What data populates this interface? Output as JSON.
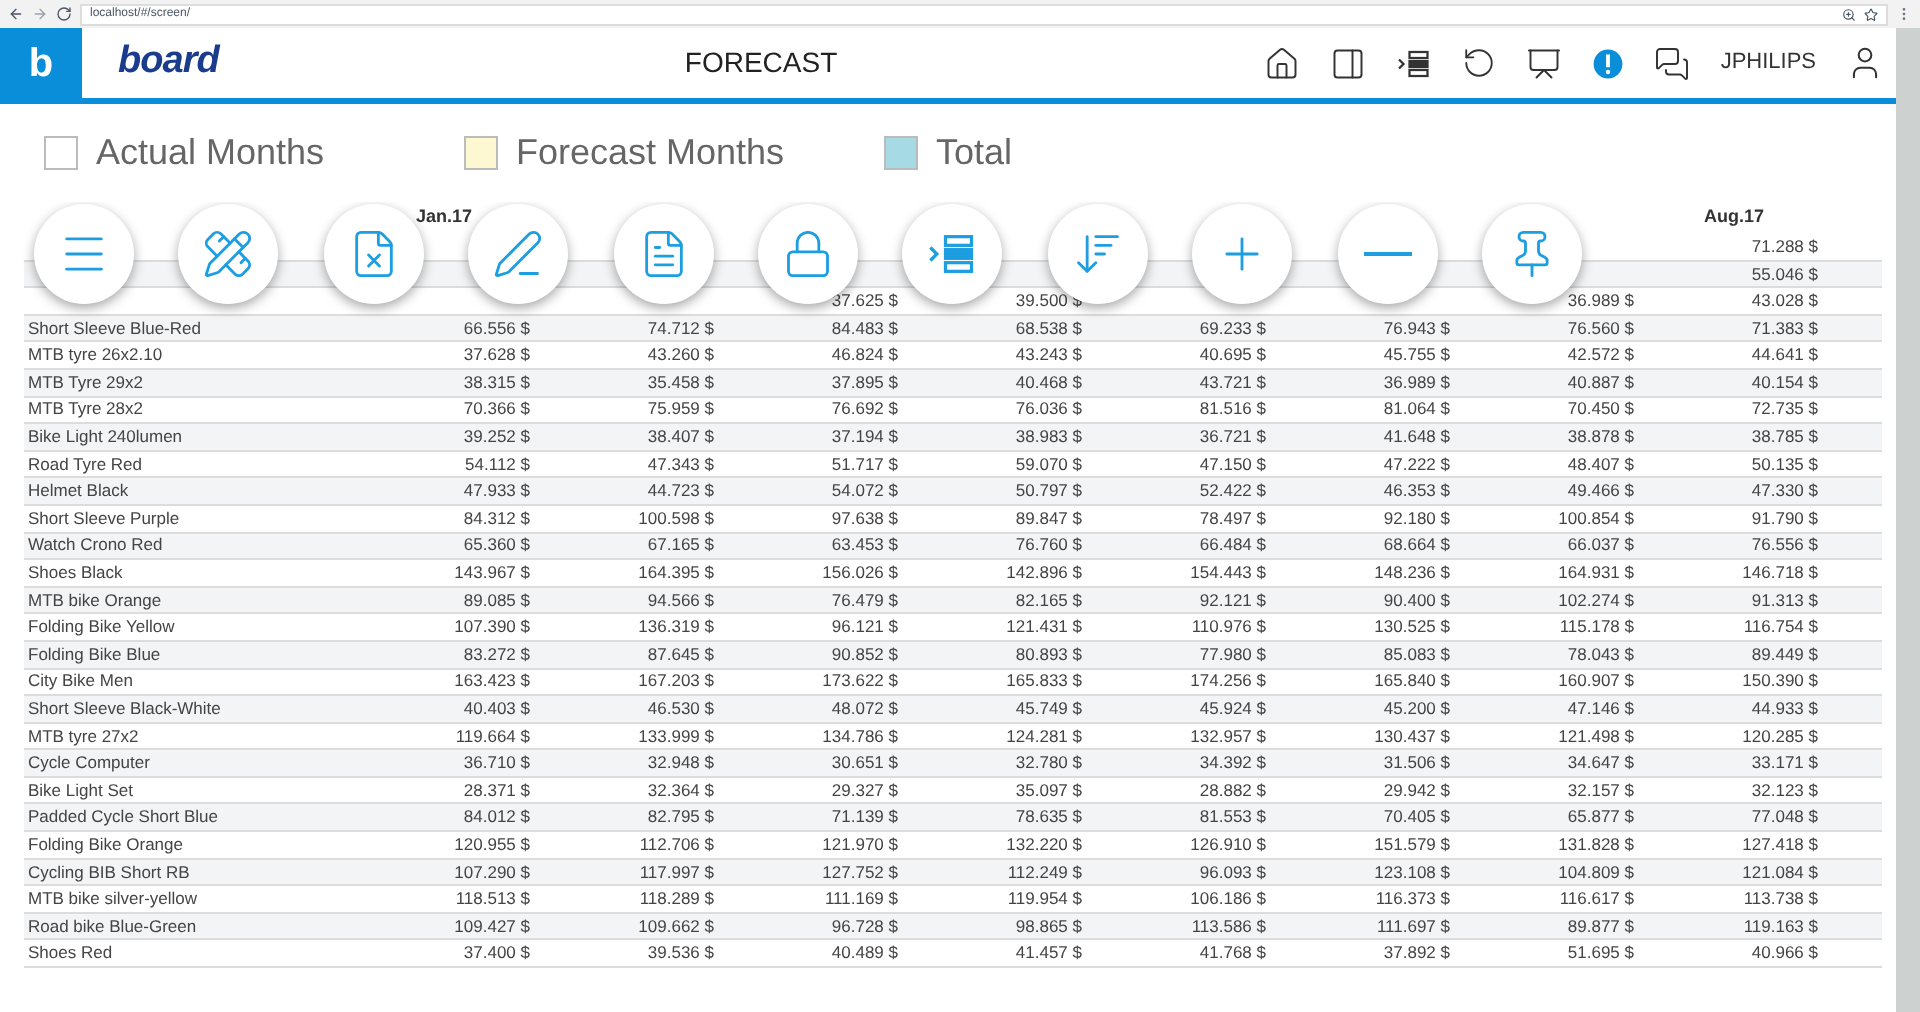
{
  "browser": {
    "url": "localhost/#/screen/"
  },
  "header": {
    "app_badge": "b",
    "logo": "board",
    "title": "FORECAST",
    "username": "JPHILIPS"
  },
  "legend": [
    {
      "label": "Actual Months",
      "color": "#ffffff"
    },
    {
      "label": "Forecast Months",
      "color": "#fdf8d2"
    },
    {
      "label": "Total",
      "color": "#a6dbe6"
    }
  ],
  "table": {
    "columns": [
      null,
      "Jan.17",
      null,
      null,
      null,
      null,
      null,
      null,
      "Aug.17"
    ],
    "rows": [
      [
        null,
        null,
        null,
        null,
        null,
        null,
        null,
        null,
        "71.288 $"
      ],
      [
        null,
        null,
        null,
        null,
        null,
        null,
        null,
        null,
        "55.046 $"
      ],
      [
        null,
        null,
        null,
        "37.625 $",
        "39.500 $",
        null,
        null,
        "36.989 $",
        "43.028 $"
      ],
      [
        "Short Sleeve Blue-Red",
        "66.556 $",
        "74.712 $",
        "84.483 $",
        "68.538 $",
        "69.233 $",
        "76.943 $",
        "76.560 $",
        "71.383 $"
      ],
      [
        "MTB tyre 26x2.10",
        "37.628 $",
        "43.260 $",
        "46.824 $",
        "43.243 $",
        "40.695 $",
        "45.755 $",
        "42.572 $",
        "44.641 $"
      ],
      [
        "MTB Tyre 29x2",
        "38.315 $",
        "35.458 $",
        "37.895 $",
        "40.468 $",
        "43.721 $",
        "36.989 $",
        "40.887 $",
        "40.154 $"
      ],
      [
        "MTB Tyre 28x2",
        "70.366 $",
        "75.959 $",
        "76.692 $",
        "76.036 $",
        "81.516 $",
        "81.064 $",
        "70.450 $",
        "72.735 $"
      ],
      [
        "Bike Light 240lumen",
        "39.252 $",
        "38.407 $",
        "37.194 $",
        "38.983 $",
        "36.721 $",
        "41.648 $",
        "38.878 $",
        "38.785 $"
      ],
      [
        "Road Tyre Red",
        "54.112 $",
        "47.343 $",
        "51.717 $",
        "59.070 $",
        "47.150 $",
        "47.222 $",
        "48.407 $",
        "50.135 $"
      ],
      [
        "Helmet Black",
        "47.933 $",
        "44.723 $",
        "54.072 $",
        "50.797 $",
        "52.422 $",
        "46.353 $",
        "49.466 $",
        "47.330 $"
      ],
      [
        "Short Sleeve Purple",
        "84.312 $",
        "100.598 $",
        "97.638 $",
        "89.847 $",
        "78.497 $",
        "92.180 $",
        "100.854 $",
        "91.790 $"
      ],
      [
        "Watch Crono Red",
        "65.360 $",
        "67.165 $",
        "63.453 $",
        "76.760 $",
        "66.484 $",
        "68.664 $",
        "66.037 $",
        "76.556 $"
      ],
      [
        "Shoes Black",
        "143.967 $",
        "164.395 $",
        "156.026 $",
        "142.896 $",
        "154.443 $",
        "148.236 $",
        "164.931 $",
        "146.718 $"
      ],
      [
        "MTB bike Orange",
        "89.085 $",
        "94.566 $",
        "76.479 $",
        "82.165 $",
        "92.121 $",
        "90.400 $",
        "102.274 $",
        "91.313 $"
      ],
      [
        "Folding Bike Yellow",
        "107.390 $",
        "136.319 $",
        "96.121 $",
        "121.431 $",
        "110.976 $",
        "130.525 $",
        "115.178 $",
        "116.754 $"
      ],
      [
        "Folding Bike Blue",
        "83.272 $",
        "87.645 $",
        "90.852 $",
        "80.893 $",
        "77.980 $",
        "85.083 $",
        "78.043 $",
        "89.449 $"
      ],
      [
        "City Bike Men",
        "163.423 $",
        "167.203 $",
        "173.622 $",
        "165.833 $",
        "174.256 $",
        "165.840 $",
        "160.907 $",
        "150.390 $"
      ],
      [
        "Short Sleeve Black-White",
        "40.403 $",
        "46.530 $",
        "48.072 $",
        "45.749 $",
        "45.924 $",
        "45.200 $",
        "47.146 $",
        "44.933 $"
      ],
      [
        "MTB tyre 27x2",
        "119.664 $",
        "133.999 $",
        "134.786 $",
        "124.281 $",
        "132.957 $",
        "130.437 $",
        "121.498 $",
        "120.285 $"
      ],
      [
        "Cycle Computer",
        "36.710 $",
        "32.948 $",
        "30.651 $",
        "32.780 $",
        "34.392 $",
        "31.506 $",
        "34.647 $",
        "33.171 $"
      ],
      [
        "Bike Light Set",
        "28.371 $",
        "32.364 $",
        "29.327 $",
        "35.097 $",
        "28.882 $",
        "29.942 $",
        "32.157 $",
        "32.123 $"
      ],
      [
        "Padded Cycle Short Blue",
        "84.012 $",
        "82.795 $",
        "71.139 $",
        "78.635 $",
        "81.553 $",
        "70.405 $",
        "65.877 $",
        "77.048 $"
      ],
      [
        "Folding Bike Orange",
        "120.955 $",
        "112.706 $",
        "121.970 $",
        "132.220 $",
        "126.910 $",
        "151.579 $",
        "131.828 $",
        "127.418 $"
      ],
      [
        "Cycling BIB Short RB",
        "107.290 $",
        "117.997 $",
        "127.752 $",
        "112.249 $",
        "96.093 $",
        "123.108 $",
        "104.809 $",
        "121.084 $"
      ],
      [
        "MTB bike silver-yellow",
        "118.513 $",
        "118.289 $",
        "111.169 $",
        "119.954 $",
        "106.186 $",
        "116.373 $",
        "116.617 $",
        "113.738 $"
      ],
      [
        "Road bike Blue-Green",
        "109.427 $",
        "109.662 $",
        "96.728 $",
        "98.865 $",
        "113.586 $",
        "111.697 $",
        "89.877 $",
        "119.163 $"
      ],
      [
        "Shoes Red",
        "37.400 $",
        "39.536 $",
        "40.489 $",
        "41.457 $",
        "41.768 $",
        "37.892 $",
        "51.695 $",
        "40.966 $"
      ]
    ]
  },
  "fab_buttons": [
    {
      "kind": "menu"
    },
    {
      "kind": "ruler"
    },
    {
      "kind": "excel"
    },
    {
      "kind": "edit"
    },
    {
      "kind": "pdf"
    },
    {
      "kind": "lock"
    },
    {
      "kind": "layout"
    },
    {
      "kind": "sort"
    },
    {
      "kind": "add"
    },
    {
      "kind": "remove"
    },
    {
      "kind": "pin"
    }
  ]
}
